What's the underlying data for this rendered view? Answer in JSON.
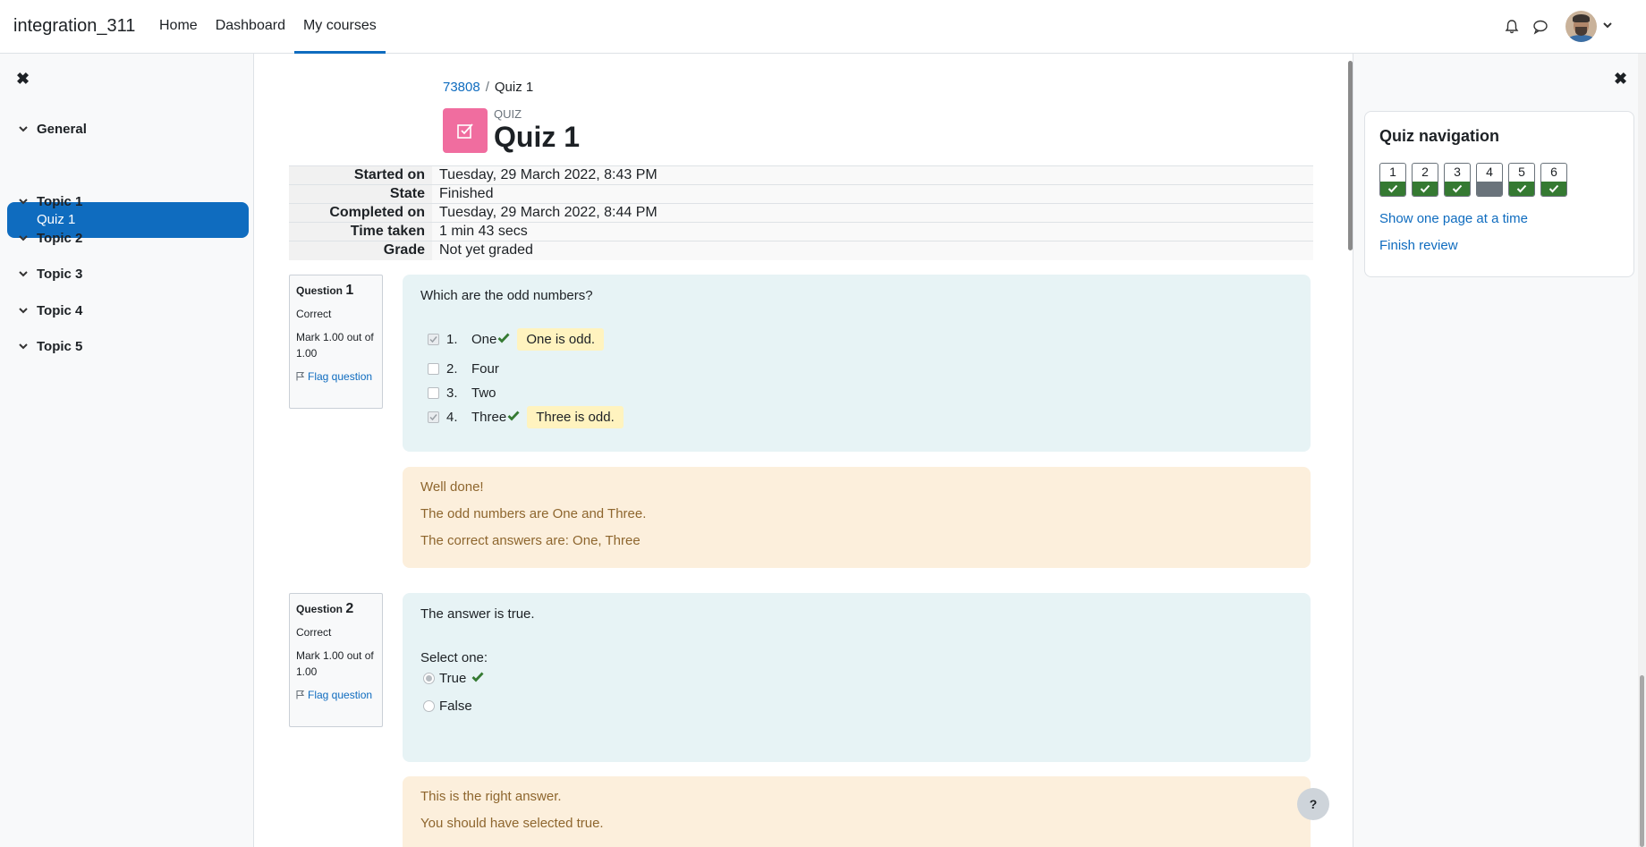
{
  "navbar": {
    "brand": "integration_311",
    "links": [
      "Home",
      "Dashboard",
      "My courses"
    ],
    "active_link": "My courses",
    "icons": [
      "bell-icon",
      "chat-icon",
      "avatar",
      "chevron-down-icon"
    ]
  },
  "left_drawer": {
    "sections": [
      "General",
      "Topic 1",
      "Topic 2",
      "Topic 3",
      "Topic 4",
      "Topic 5"
    ],
    "active_item": "Quiz 1"
  },
  "breadcrumb": {
    "course": "73808",
    "current": "Quiz 1"
  },
  "page_header": {
    "kind": "QUIZ",
    "title": "Quiz 1",
    "icon": "quiz-icon",
    "icon_color": "#f06d9f"
  },
  "summary": [
    {
      "label": "Started on",
      "value": "Tuesday, 29 March 2022, 8:43 PM"
    },
    {
      "label": "State",
      "value": "Finished"
    },
    {
      "label": "Completed on",
      "value": "Tuesday, 29 March 2022, 8:44 PM"
    },
    {
      "label": "Time taken",
      "value": "1 min 43 secs"
    },
    {
      "label": "Grade",
      "value": "Not yet graded"
    }
  ],
  "questions": [
    {
      "label": "Question",
      "number": "1",
      "state": "Correct",
      "mark": "Mark 1.00 out of 1.00",
      "flag": "Flag question",
      "text": "Which are the odd numbers?",
      "answers": [
        {
          "num": "1.",
          "text": "One",
          "checked": true,
          "correct": true,
          "feedback": "One is odd."
        },
        {
          "num": "2.",
          "text": "Four",
          "checked": false
        },
        {
          "num": "3.",
          "text": "Two",
          "checked": false
        },
        {
          "num": "4.",
          "text": "Three",
          "checked": true,
          "correct": true,
          "feedback": "Three is odd."
        }
      ],
      "feedback": [
        "Well done!",
        "The odd numbers are One and Three.",
        "The correct answers are: One, Three"
      ]
    },
    {
      "label": "Question",
      "number": "2",
      "state": "Correct",
      "mark": "Mark 1.00 out of 1.00",
      "flag": "Flag question",
      "text": "The answer is true.",
      "prompt": "Select one:",
      "options": [
        {
          "text": "True",
          "selected": true,
          "correct": true
        },
        {
          "text": "False",
          "selected": false
        }
      ],
      "feedback": [
        "This is the right answer.",
        "You should have selected true."
      ]
    }
  ],
  "quiz_nav": {
    "title": "Quiz navigation",
    "buttons": [
      {
        "num": "1",
        "status": "correct"
      },
      {
        "num": "2",
        "status": "correct"
      },
      {
        "num": "3",
        "status": "correct"
      },
      {
        "num": "4",
        "status": "not-graded"
      },
      {
        "num": "5",
        "status": "correct"
      },
      {
        "num": "6",
        "status": "correct"
      }
    ],
    "links": [
      "Show one page at a time",
      "Finish review"
    ]
  },
  "help_button": "?",
  "colors": {
    "accent": "#0f6cbf",
    "correct": "#357a32",
    "question_bg": "#e7f3f5",
    "feedback_bg": "#fcefdc"
  }
}
